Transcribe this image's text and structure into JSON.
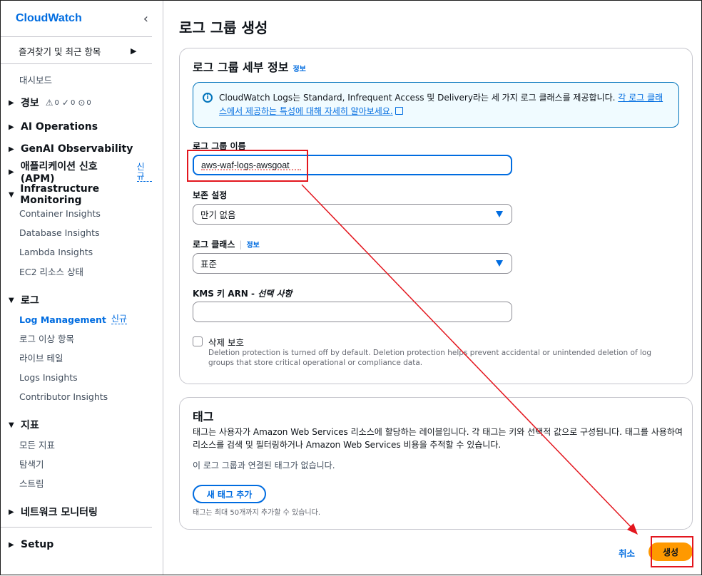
{
  "sidebar": {
    "title": "CloudWatch",
    "collapse_icon": "‹",
    "favorites": "즐겨찾기 및 최근 항목",
    "dashboard": "대시보드",
    "alarms": {
      "label": "경보",
      "warn": "0",
      "ok": "0",
      "pending": "0"
    },
    "ai_ops": "AI Operations",
    "genai": "GenAI Observability",
    "apm": "애플리케이션 신호 (APM)",
    "new_badge": "신규",
    "infra": {
      "label": "Infrastructure Monitoring",
      "items": [
        "Container Insights",
        "Database Insights",
        "Lambda Insights",
        "EC2 리소스 상태"
      ]
    },
    "logs": {
      "label": "로그",
      "items": [
        "Log Management",
        "로그 이상 항목",
        "라이브 테일",
        "Logs Insights",
        "Contributor Insights"
      ]
    },
    "metrics": {
      "label": "지표",
      "items": [
        "모든 지표",
        "탐색기",
        "스트림"
      ]
    },
    "network": "네트워크 모니터링",
    "setup": "Setup"
  },
  "page": {
    "title": "로그 그룹 생성"
  },
  "details": {
    "title": "로그 그룹 세부 정보",
    "info": "정보",
    "alert_text": "CloudWatch Logs는 Standard, Infrequent Access 및 Delivery라는 세 가지 로그 클래스를 제공합니다.",
    "alert_link": "각 로그 클래스에서 제공하는 특성에 대해 자세히 알아보세요.",
    "name_label": "로그 그룹 이름",
    "name_value": "aws-waf-logs-awsgoat",
    "retention_label": "보존 설정",
    "retention_value": "만기 없음",
    "class_label": "로그 클래스",
    "class_info": "정보",
    "class_value": "표준",
    "kms_label": "KMS 키 ARN - ",
    "kms_optional": "선택 사항",
    "kms_value": "",
    "deletion_label": "삭제 보호",
    "deletion_desc": "Deletion protection is turned off by default. Deletion protection helps prevent accidental or unintended deletion of log groups that store critical operational or compliance data."
  },
  "tags": {
    "title": "태그",
    "desc": "태그는 사용자가 Amazon Web Services 리소스에 할당하는 레이블입니다. 각 태그는 키와 선택적 값으로 구성됩니다. 태그를 사용하여 리소스를 검색 및 필터링하거나 Amazon Web Services 비용을 추적할 수 있습니다.",
    "empty": "이 로그 그룹과 연결된 태그가 없습니다.",
    "add_button": "새 태그 추가",
    "note": "태그는 최대 50개까지 추가할 수 있습니다."
  },
  "actions": {
    "cancel": "취소",
    "create": "생성"
  },
  "colors": {
    "accent": "#006ce0",
    "primary": "#ff9900",
    "annotation": "#e3161e"
  }
}
